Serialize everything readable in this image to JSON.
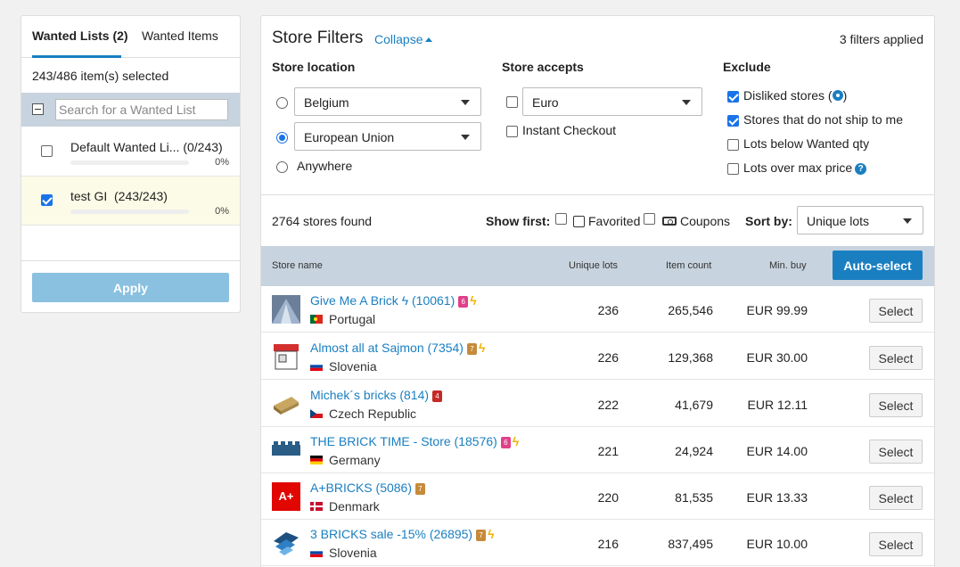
{
  "wanted": {
    "tab_lists": "Wanted Lists (2)",
    "tab_items": "Wanted Items",
    "selected_count": "243/486 item(s) selected",
    "search_placeholder": "Search for a Wanted List",
    "lists": [
      {
        "name": "Default Wanted Li...",
        "count": "(0/243)",
        "pct": "0%",
        "checked": false
      },
      {
        "name": "test GI",
        "count": "(243/243)",
        "pct": "0%",
        "checked": true
      }
    ],
    "apply_label": "Apply"
  },
  "filters": {
    "title": "Store Filters",
    "collapse_label": "Collapse",
    "applied_text": "3 filters applied",
    "location_heading": "Store location",
    "location_country": "Belgium",
    "location_region": "European Union",
    "location_anywhere": "Anywhere",
    "accepts_heading": "Store accepts",
    "currency": "Euro",
    "instant_checkout": "Instant Checkout",
    "exclude_heading": "Exclude",
    "exclude_items": [
      {
        "label": "Disliked stores (",
        "suffix": ")",
        "checked": true
      },
      {
        "label": "Stores that do not ship to me",
        "checked": true
      },
      {
        "label": "Lots below Wanted qty",
        "checked": false
      },
      {
        "label": "Lots over max price",
        "checked": false
      }
    ]
  },
  "results": {
    "stores_found": "2764 stores found",
    "show_first": "Show first:",
    "favorited": "Favorited",
    "coupons": "Coupons",
    "sort_by": "Sort by:",
    "sort_value": "Unique lots"
  },
  "table": {
    "col_store": "Store name",
    "col_unique": "Unique lots",
    "col_items": "Item count",
    "col_min": "Min. buy",
    "autoselect_label": "Auto-select",
    "select_label": "Select",
    "rows": [
      {
        "name": "Give Me A Brick ϟ (10061)",
        "country": "Portugal",
        "unique": "236",
        "items": "265,546",
        "min": "EUR 99.99"
      },
      {
        "name": "Almost all at Sajmon (7354)",
        "country": "Slovenia",
        "unique": "226",
        "items": "129,368",
        "min": "EUR 30.00"
      },
      {
        "name": "Michek´s bricks (814)",
        "country": "Czech Republic",
        "unique": "222",
        "items": "41,679",
        "min": "EUR 12.11"
      },
      {
        "name": "THE BRICK TIME - Store (18576)",
        "country": "Germany",
        "unique": "221",
        "items": "24,924",
        "min": "EUR 14.00"
      },
      {
        "name": "A+BRICKS (5086)",
        "country": "Denmark",
        "unique": "220",
        "items": "81,535",
        "min": "EUR 13.33"
      },
      {
        "name": "3 BRICKS sale -15% (26895)",
        "country": "Slovenia",
        "unique": "216",
        "items": "837,495",
        "min": "EUR 10.00"
      }
    ]
  },
  "colors": {
    "accent": "#1a7fc1",
    "header_bg": "#c7d3de",
    "bolt": "#f0b400"
  }
}
